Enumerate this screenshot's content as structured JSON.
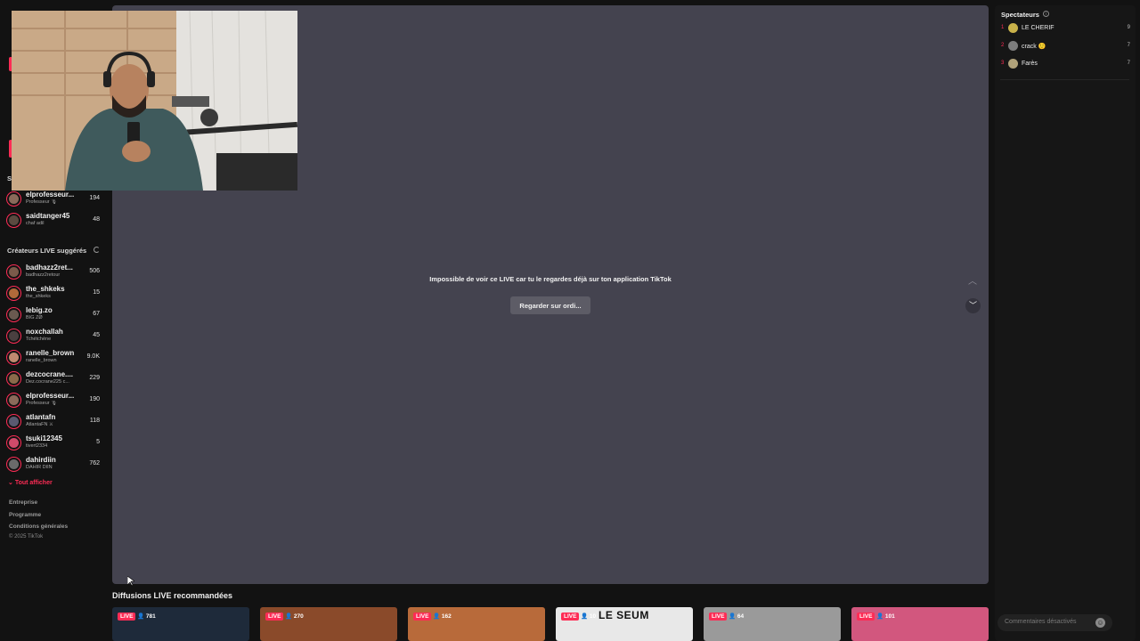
{
  "sidebar": {
    "followed_section_title": "S",
    "followed": [
      {
        "name": "elprofesseur...",
        "sub": "Professeur 🎙",
        "count": "194"
      },
      {
        "name": "saidtanger45",
        "sub": "chaf adil",
        "count": "48"
      }
    ],
    "suggested_title": "Créateurs LIVE suggérés",
    "suggested": [
      {
        "name": "badhazz2ret...",
        "sub": "badhazz2retour",
        "count": "506"
      },
      {
        "name": "the_shkeks",
        "sub": "the_shkeks",
        "count": "15"
      },
      {
        "name": "lebig.zo",
        "sub": "BIG ZØ",
        "count": "67"
      },
      {
        "name": "noxchallah",
        "sub": "Tchétchène",
        "count": "45"
      },
      {
        "name": "ranelle_brown",
        "sub": "ranelle_brown",
        "count": "9.0K"
      },
      {
        "name": "dezcocrane....",
        "sub": "Dez.cocrane225 c...",
        "count": "229"
      },
      {
        "name": "elprofesseur...",
        "sub": "Professeur 🎙",
        "count": "190"
      },
      {
        "name": "atlantafn",
        "sub": "AtlantaFN ⚔",
        "count": "118"
      },
      {
        "name": "tsuki12345",
        "sub": "tivert2334",
        "count": "5"
      },
      {
        "name": "dahirdiin",
        "sub": "DAHIR DIIN",
        "count": "762"
      }
    ],
    "show_all": "Tout afficher",
    "footer": [
      "Entreprise",
      "Programme",
      "Conditions générales"
    ],
    "copyright": "© 2025 TikTok"
  },
  "player": {
    "message": "Impossible de voir ce LIVE car tu le regardes déjà sur ton application TikTok",
    "watch_button": "Regarder sur ordi..."
  },
  "viewers": {
    "title": "Spectateurs",
    "list": [
      {
        "rank": "1",
        "name": "LE CHERIF",
        "score": "9",
        "color": "#c9b24a"
      },
      {
        "rank": "2",
        "name": "crack 🙂",
        "score": "7",
        "color": "#7d7d7d"
      },
      {
        "rank": "3",
        "name": "Farès",
        "score": "7",
        "color": "#b0a27a"
      }
    ],
    "comments_placeholder": "Commentaires désactivés"
  },
  "recommended": {
    "title": "Diffusions LIVE recommandées",
    "live_label": "LIVE",
    "cards": [
      {
        "viewers": "781",
        "bg": "#1e2a3a",
        "text": ""
      },
      {
        "viewers": "270",
        "bg": "#8a4a2a",
        "text": ""
      },
      {
        "viewers": "162",
        "bg": "#b86a3a",
        "text": ""
      },
      {
        "viewers": "10",
        "bg": "#e8e8e8",
        "text": "LE SEUM"
      },
      {
        "viewers": "64",
        "bg": "#9a9a9a",
        "text": ""
      },
      {
        "viewers": "101",
        "bg": "#d2577e",
        "text": ""
      }
    ]
  },
  "colors": {
    "accent": "#fe2c55",
    "player_bg": "#44434f"
  }
}
